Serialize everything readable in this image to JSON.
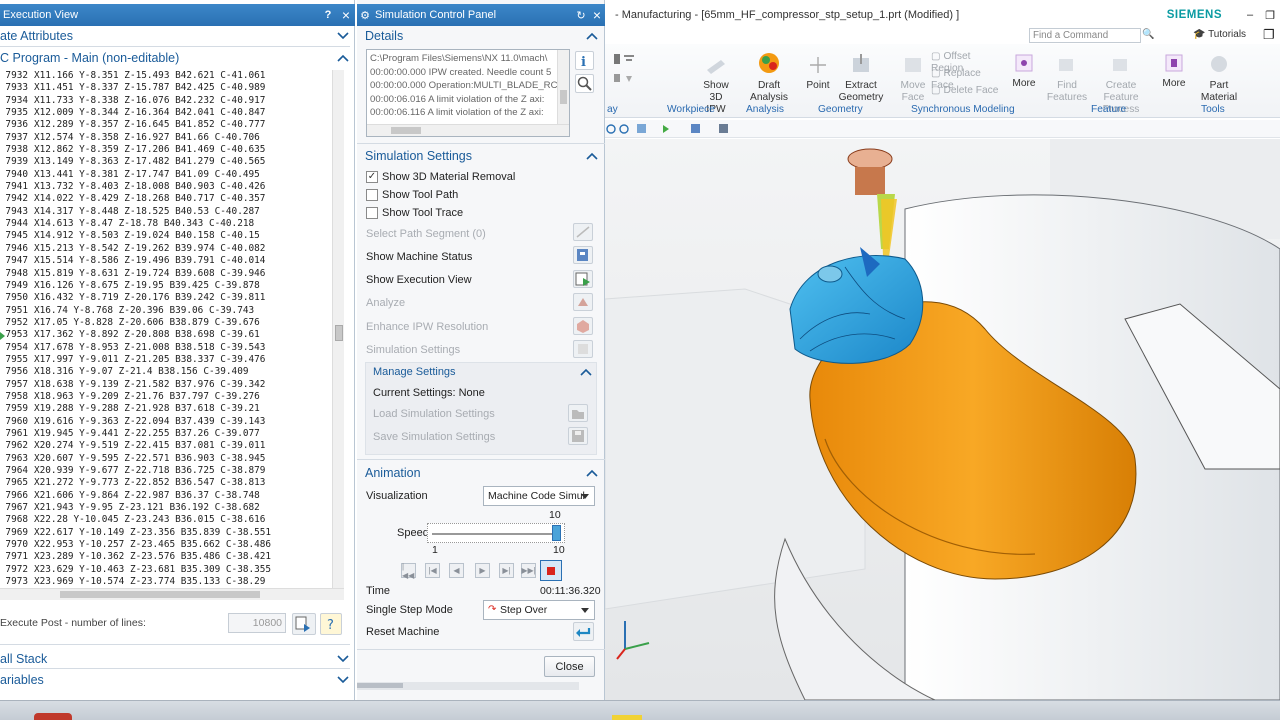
{
  "exec_view": {
    "title": "Execution View",
    "help": "?",
    "close": "×",
    "section_state": "ate Attributes",
    "section_program": "C Program - Main (non-editable)",
    "lines": [
      [
        "7932",
        "X11.166 Y-8.351 Z-15.493 B42.621 C-41.061"
      ],
      [
        "7933",
        "X11.451 Y-8.337 Z-15.787 B42.425 C-40.989"
      ],
      [
        "7934",
        "X11.733 Y-8.338 Z-16.076 B42.232 C-40.917"
      ],
      [
        "7935",
        "X12.009 Y-8.344 Z-16.364 B42.041 C-40.847"
      ],
      [
        "7936",
        "X12.289 Y-8.357 Z-16.645 B41.852 C-40.777"
      ],
      [
        "7937",
        "X12.574 Y-8.358 Z-16.927 B41.66 C-40.706"
      ],
      [
        "7938",
        "X12.862 Y-8.359 Z-17.206 B41.469 C-40.635"
      ],
      [
        "7939",
        "X13.149 Y-8.363 Z-17.482 B41.279 C-40.565"
      ],
      [
        "7940",
        "X13.441 Y-8.381 Z-17.747 B41.09 C-40.495"
      ],
      [
        "7941",
        "X13.732 Y-8.403 Z-18.008 B40.903 C-40.426"
      ],
      [
        "7942",
        "X14.022 Y-8.429 Z-18.268 B40.717 C-40.357"
      ],
      [
        "7943",
        "X14.317 Y-8.448 Z-18.525 B40.53 C-40.287"
      ],
      [
        "7944",
        "X14.613 Y-8.47 Z-18.78 B40.343 C-40.218"
      ],
      [
        "7945",
        "X14.912 Y-8.503 Z-19.024 B40.158 C-40.15"
      ],
      [
        "7946",
        "X15.213 Y-8.542 Z-19.262 B39.974 C-40.082"
      ],
      [
        "7947",
        "X15.514 Y-8.586 Z-19.496 B39.791 C-40.014"
      ],
      [
        "7948",
        "X15.819 Y-8.631 Z-19.724 B39.608 C-39.946"
      ],
      [
        "7949",
        "X16.126 Y-8.675 Z-19.95 B39.425 C-39.878"
      ],
      [
        "7950",
        "X16.432 Y-8.719 Z-20.176 B39.242 C-39.811"
      ],
      [
        "7951",
        "X16.74 Y-8.768 Z-20.396 B39.06 C-39.743"
      ],
      [
        "7952",
        "X17.05 Y-8.828 Z-20.606 B38.879 C-39.676"
      ],
      [
        "7953",
        "X17.362 Y-8.892 Z-20.808 B38.698 C-39.61"
      ],
      [
        "7954",
        "X17.678 Y-8.953 Z-21.008 B38.518 C-39.543"
      ],
      [
        "7955",
        "X17.997 Y-9.011 Z-21.205 B38.337 C-39.476"
      ],
      [
        "7956",
        "X18.316 Y-9.07 Z-21.4 B38.156 C-39.409"
      ],
      [
        "7957",
        "X18.638 Y-9.139 Z-21.582 B37.976 C-39.342"
      ],
      [
        "7958",
        "X18.963 Y-9.209 Z-21.76 B37.797 C-39.276"
      ],
      [
        "7959",
        "X19.288 Y-9.288 Z-21.928 B37.618 C-39.21"
      ],
      [
        "7960",
        "X19.616 Y-9.363 Z-22.094 B37.439 C-39.143"
      ],
      [
        "7961",
        "X19.945 Y-9.441 Z-22.255 B37.26 C-39.077"
      ],
      [
        "7962",
        "X20.274 Y-9.519 Z-22.415 B37.081 C-39.011"
      ],
      [
        "7963",
        "X20.607 Y-9.595 Z-22.571 B36.903 C-38.945"
      ],
      [
        "7964",
        "X20.939 Y-9.677 Z-22.718 B36.725 C-38.879"
      ],
      [
        "7965",
        "X21.272 Y-9.773 Z-22.852 B36.547 C-38.813"
      ],
      [
        "7966",
        "X21.606 Y-9.864 Z-22.987 B36.37 C-38.748"
      ],
      [
        "7967",
        "X21.943 Y-9.95 Z-23.121 B36.192 C-38.682"
      ],
      [
        "7968",
        "X22.28 Y-10.045 Z-23.243 B36.015 C-38.616"
      ],
      [
        "7969",
        "X22.617 Y-10.149 Z-23.356 B35.839 C-38.551"
      ],
      [
        "7970",
        "X22.953 Y-10.257 Z-23.465 B35.662 C-38.486"
      ],
      [
        "7971",
        "X23.289 Y-10.362 Z-23.576 B35.486 C-38.421"
      ],
      [
        "7972",
        "X23.629 Y-10.463 Z-23.681 B35.309 C-38.355"
      ],
      [
        "7973",
        "X23.969 Y-10.574 Z-23.774 B35.133 C-38.29"
      ]
    ],
    "execute_post_label": "Execute Post - number of lines:",
    "execute_post_value": "10800",
    "call_stack": "all Stack",
    "variables": "ariables"
  },
  "scp": {
    "title": "Simulation Control Panel",
    "close": "×",
    "details_title": "Details",
    "details_lines": [
      "C:\\Program Files\\Siemens\\NX 11.0\\mach\\",
      "00:00:00.000 IPW created. Needle count 5",
      "00:00:00.000 Operation:MULTI_BLADE_RC",
      "00:00:06.016 A limit violation of the Z axi:",
      "00:00:06.116 A limit violation of the Z axi:"
    ],
    "sim_settings_title": "Simulation Settings",
    "show_3d": "Show 3D Material Removal",
    "show_tool_path": "Show Tool Path",
    "show_tool_trace": "Show Tool Trace",
    "select_path": "Select Path Segment (0)",
    "show_machine_status": "Show Machine Status",
    "show_exec_view": "Show Execution View",
    "analyze": "Analyze",
    "enhance_ipw": "Enhance IPW Resolution",
    "simulation_settings": "Simulation Settings",
    "manage_settings": "Manage Settings",
    "current_settings": "Current Settings: None",
    "load_settings": "Load Simulation Settings",
    "save_settings": "Save Simulation Settings",
    "animation_title": "Animation",
    "visualization_label": "Visualization",
    "visualization_value": "Machine Code Simul",
    "speed_label": "Speed",
    "speed_value": "10",
    "speed_min": "1",
    "speed_max": "10",
    "speed_fraction": 1.0,
    "time_label": "Time",
    "time_value": "00:11:36.320",
    "single_step_label": "Single Step Mode",
    "single_step_value": "Step Over",
    "reset_label": "Reset Machine",
    "close_button": "Close"
  },
  "nx": {
    "title": "- Manufacturing - [65mm_HF_compressor_stp_setup_1.prt (Modified) ]",
    "brand": "SIEMENS",
    "find_placeholder": "Find a Command",
    "tutorials": "Tutorials",
    "ribbon": {
      "show3d": "Show 3D\nIPW",
      "draft": "Draft\nAnalysis",
      "point": "Point",
      "extract": "Extract\nGeometry",
      "move_face": "Move\nFace",
      "offset_region": "Offset Region",
      "replace_face": "Replace Face",
      "delete_face": "Delete Face",
      "more1": "More",
      "find_features": "Find\nFeatures",
      "create_feature": "Create Feature\nProcess",
      "more2": "More",
      "part_material": "Part\nMaterial"
    },
    "groups": {
      "ay": "ay",
      "workpiece": "Workpiece",
      "analysis": "Analysis",
      "geometry": "Geometry",
      "synchronous": "Synchronous Modeling",
      "feature": "Feature",
      "tools": "Tools"
    }
  },
  "colors": {
    "accent": "#2a70b3",
    "tool_orange": "#f39a12",
    "tool_blue": "#2f9fd8"
  }
}
